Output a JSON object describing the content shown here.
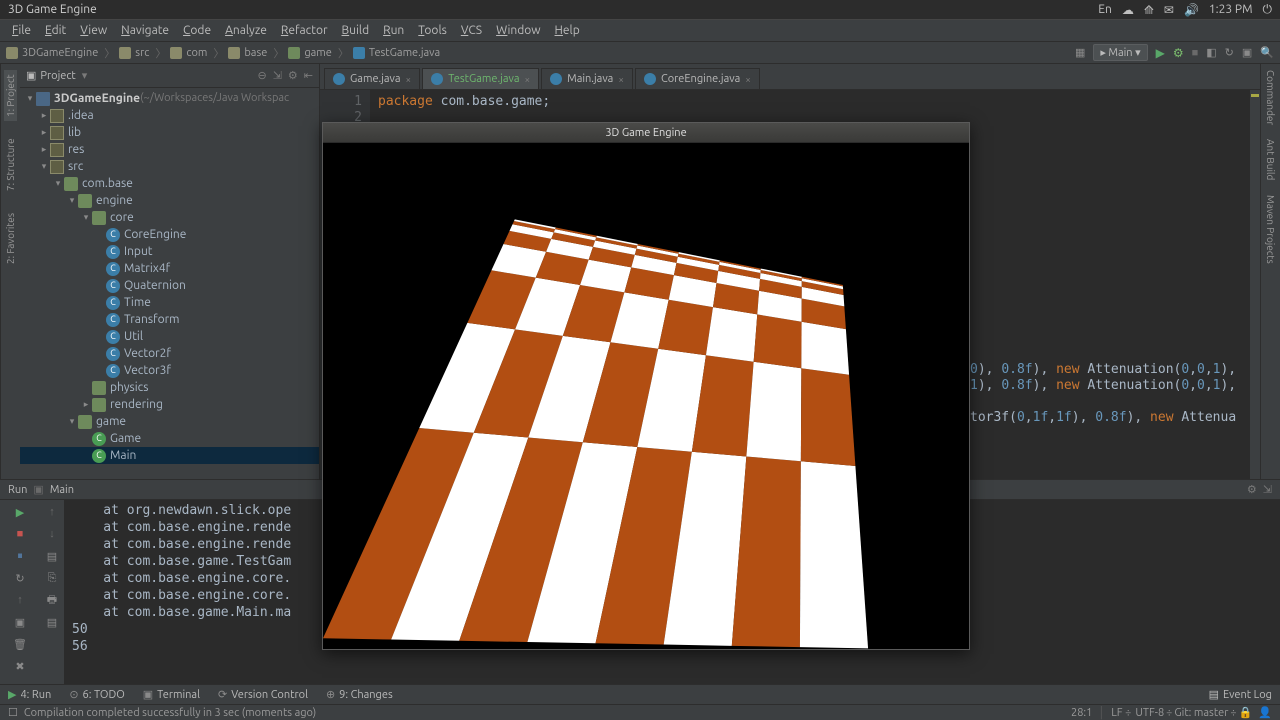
{
  "os": {
    "title": "3D Game Engine",
    "lang": "En",
    "clock": "1:23 PM"
  },
  "menu": [
    "File",
    "Edit",
    "View",
    "Navigate",
    "Code",
    "Analyze",
    "Refactor",
    "Build",
    "Run",
    "Tools",
    "VCS",
    "Window",
    "Help"
  ],
  "breadcrumb": [
    {
      "label": "3DGameEngine",
      "type": "mod"
    },
    {
      "label": "src",
      "type": "dir"
    },
    {
      "label": "com",
      "type": "dir"
    },
    {
      "label": "base",
      "type": "dir"
    },
    {
      "label": "game",
      "type": "pkg"
    },
    {
      "label": "TestGame.java",
      "type": "cls"
    }
  ],
  "run_config": "Main",
  "sidebar": {
    "left": [
      "1: Project",
      "7: Structure"
    ],
    "right": [
      "Commander",
      "Ant Build",
      "Maven Projects"
    ],
    "bottom": "2: Favorites"
  },
  "project": {
    "header": "Project",
    "root": {
      "label": "3DGameEngine",
      "loc": "(~/Workspaces/Java Workspac"
    },
    "nodes": [
      {
        "depth": 1,
        "tw": "▸",
        "ic": "dir",
        "label": ".idea"
      },
      {
        "depth": 1,
        "tw": "▸",
        "ic": "dir",
        "label": "lib"
      },
      {
        "depth": 1,
        "tw": "▸",
        "ic": "dir",
        "label": "res"
      },
      {
        "depth": 1,
        "tw": "▾",
        "ic": "dir",
        "label": "src"
      },
      {
        "depth": 2,
        "tw": "▾",
        "ic": "pkg",
        "label": "com.base"
      },
      {
        "depth": 3,
        "tw": "▾",
        "ic": "pkg",
        "label": "engine"
      },
      {
        "depth": 4,
        "tw": "▾",
        "ic": "pkg",
        "label": "core"
      },
      {
        "depth": 5,
        "tw": "",
        "ic": "jclass",
        "label": "CoreEngine"
      },
      {
        "depth": 5,
        "tw": "",
        "ic": "jclass",
        "label": "Input"
      },
      {
        "depth": 5,
        "tw": "",
        "ic": "jclass",
        "label": "Matrix4f"
      },
      {
        "depth": 5,
        "tw": "",
        "ic": "jclass",
        "label": "Quaternion"
      },
      {
        "depth": 5,
        "tw": "",
        "ic": "jclass",
        "label": "Time"
      },
      {
        "depth": 5,
        "tw": "",
        "ic": "jclass",
        "label": "Transform"
      },
      {
        "depth": 5,
        "tw": "",
        "ic": "jclass",
        "label": "Util"
      },
      {
        "depth": 5,
        "tw": "",
        "ic": "jclass",
        "label": "Vector2f"
      },
      {
        "depth": 5,
        "tw": "",
        "ic": "jclass",
        "label": "Vector3f"
      },
      {
        "depth": 4,
        "tw": "",
        "ic": "pkg",
        "label": "physics"
      },
      {
        "depth": 4,
        "tw": "▸",
        "ic": "pkg",
        "label": "rendering"
      },
      {
        "depth": 3,
        "tw": "▾",
        "ic": "pkg",
        "label": "game"
      },
      {
        "depth": 4,
        "tw": "",
        "ic": "jrun",
        "label": "Game"
      },
      {
        "depth": 4,
        "tw": "",
        "ic": "jrun",
        "label": "Main",
        "sel": true
      }
    ]
  },
  "tabs": [
    {
      "label": "Game.java",
      "active": false
    },
    {
      "label": "TestGame.java",
      "active": true
    },
    {
      "label": "Main.java",
      "active": false
    },
    {
      "label": "CoreEngine.java",
      "active": false
    }
  ],
  "code": {
    "lines": [
      "1",
      "2"
    ],
    "text": "package com.base.game;",
    "visible_fragments": [
      "0), 0.8f), new Attenuation(0,0,1),",
      "1), 0.8f), new Attenuation(0,0,1),",
      "",
      "tor3f(0,1f,1f), 0.8f), new Attenua"
    ]
  },
  "run": {
    "header": "Run",
    "config": "Main",
    "lines": [
      "    at org.newdawn.slick.ope",
      "    at com.base.engine.rende",
      "    at com.base.engine.rende",
      "    at com.base.game.TestGam",
      "    at com.base.engine.core.",
      "    at com.base.engine.core.",
      "    at com.base.game.Main.ma",
      "50",
      "56"
    ]
  },
  "bottom": {
    "items": [
      {
        "icon": "▶",
        "label": "4: Run",
        "accent": "#59a869"
      },
      {
        "icon": "⊙",
        "label": "6: TODO"
      },
      {
        "icon": "▣",
        "label": "Terminal"
      },
      {
        "icon": "⟳",
        "label": "Version Control"
      },
      {
        "icon": "⊕",
        "label": "9: Changes"
      }
    ],
    "eventlog": "Event Log"
  },
  "status": {
    "msg": "Compilation completed successfully in 3 sec (moments ago)",
    "pos": "28:1",
    "sep": "LF",
    "enc": "UTF-8",
    "git": "Git: master"
  },
  "gamewin": {
    "title": "3D Game Engine"
  }
}
